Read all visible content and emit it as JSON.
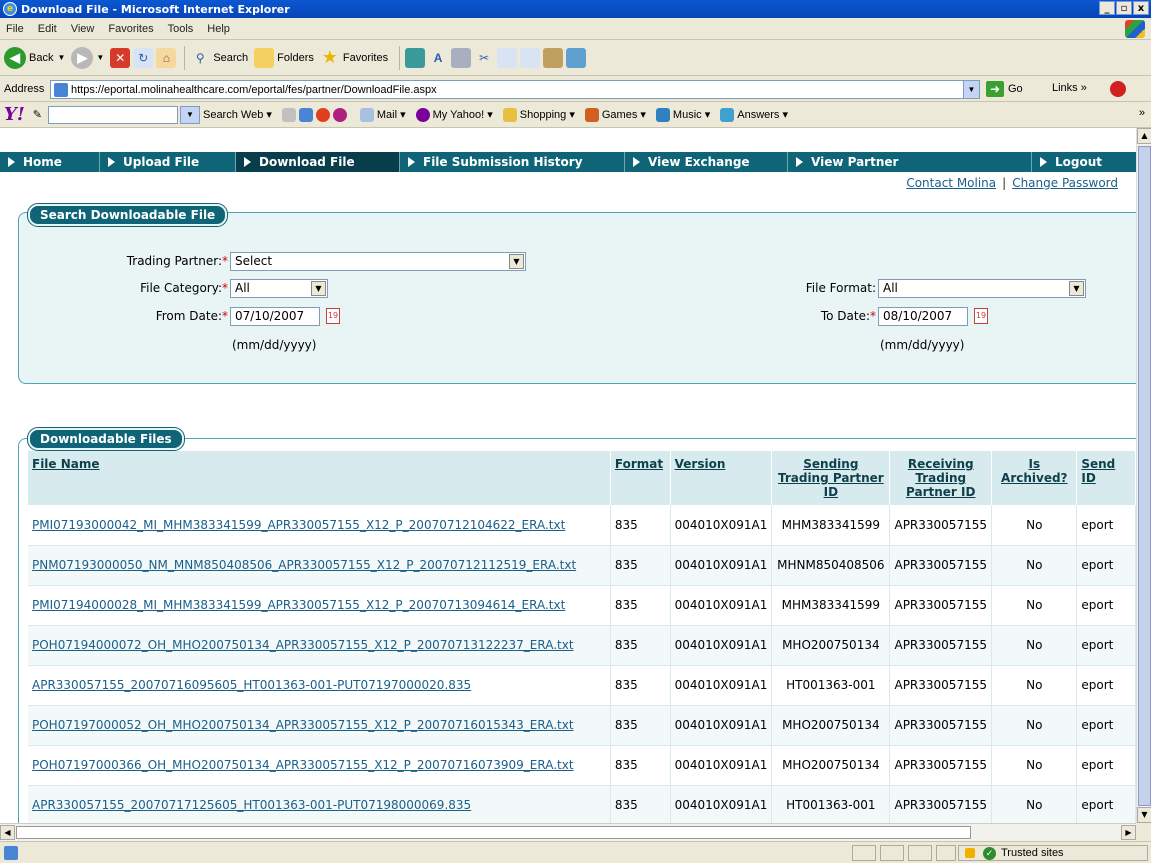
{
  "window": {
    "title": "Download File - Microsoft Internet Explorer",
    "controls": [
      "_",
      " ",
      "x"
    ]
  },
  "menu": [
    "File",
    "Edit",
    "View",
    "Favorites",
    "Tools",
    "Help"
  ],
  "toolbar": {
    "back": "Back",
    "search": "Search",
    "folders": "Folders",
    "favorites": "Favorites"
  },
  "address": {
    "label": "Address",
    "url": "https://eportal.molinahealthcare.com/eportal/fes/partner/DownloadFile.aspx",
    "go": "Go",
    "links": "Links"
  },
  "yahoo": {
    "search_web": "Search Web",
    "mail": "Mail",
    "my_yahoo": "My Yahoo!",
    "shopping": "Shopping",
    "games": "Games",
    "music": "Music",
    "answers": "Answers"
  },
  "nav": [
    {
      "label": "Home"
    },
    {
      "label": "Upload File"
    },
    {
      "label": "Download File",
      "active": true
    },
    {
      "label": "File Submission History"
    },
    {
      "label": "View Exchange"
    },
    {
      "label": "View Partner"
    },
    {
      "label": "Logout"
    }
  ],
  "toplinks": {
    "contact": "Contact Molina",
    "change_password": "Change Password"
  },
  "search_panel": {
    "title": "Search Downloadable File",
    "trading_partner_label": "Trading Partner:",
    "trading_partner_value": "Select",
    "file_category_label": "File Category:",
    "file_category_value": "All",
    "file_format_label": "File Format:",
    "file_format_value": "All",
    "from_date_label": "From Date:",
    "from_date_value": "07/10/2007",
    "to_date_label": "To Date:",
    "to_date_value": "08/10/2007",
    "date_hint": "(mm/dd/yyyy)"
  },
  "files_panel": {
    "title": "Downloadable Files",
    "columns": [
      "File Name",
      "Format",
      "Version",
      "Sending Trading Partner ID",
      "Receiving Trading Partner ID",
      "Is Archived?",
      "Send ID"
    ],
    "rows": [
      [
        "PMI07193000042_MI_MHM383341599_APR330057155_X12_P_20070712104622_ERA.txt",
        "835",
        "004010X091A1",
        "MHM383341599",
        "APR330057155",
        "No",
        "eport"
      ],
      [
        "PNM07193000050_NM_MNM850408506_APR330057155_X12_P_20070712112519_ERA.txt",
        "835",
        "004010X091A1",
        "MHNM850408506",
        "APR330057155",
        "No",
        "eport"
      ],
      [
        "PMI07194000028_MI_MHM383341599_APR330057155_X12_P_20070713094614_ERA.txt",
        "835",
        "004010X091A1",
        "MHM383341599",
        "APR330057155",
        "No",
        "eport"
      ],
      [
        "POH07194000072_OH_MHO200750134_APR330057155_X12_P_20070713122237_ERA.txt",
        "835",
        "004010X091A1",
        "MHO200750134",
        "APR330057155",
        "No",
        "eport"
      ],
      [
        "APR330057155_20070716095605_HT001363-001-PUT07197000020.835",
        "835",
        "004010X091A1",
        "HT001363-001",
        "APR330057155",
        "No",
        "eport"
      ],
      [
        "POH07197000052_OH_MHO200750134_APR330057155_X12_P_20070716015343_ERA.txt",
        "835",
        "004010X091A1",
        "MHO200750134",
        "APR330057155",
        "No",
        "eport"
      ],
      [
        "POH07197000366_OH_MHO200750134_APR330057155_X12_P_20070716073909_ERA.txt",
        "835",
        "004010X091A1",
        "MHO200750134",
        "APR330057155",
        "No",
        "eport"
      ],
      [
        "APR330057155_20070717125605_HT001363-001-PUT07198000069.835",
        "835",
        "004010X091A1",
        "HT001363-001",
        "APR330057155",
        "No",
        "eport"
      ]
    ]
  },
  "status": {
    "zone": "Trusted sites"
  }
}
